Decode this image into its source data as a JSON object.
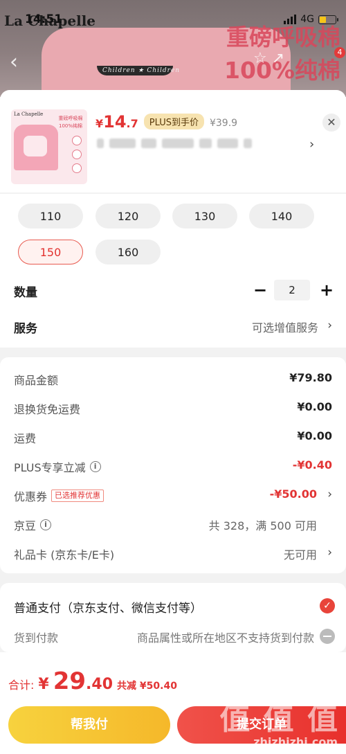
{
  "status_bar": {
    "time": "14:51",
    "network": "4G"
  },
  "banner": {
    "brand": "La Chapelle",
    "collar_text": "Children ★ Children",
    "promo_line1": "重磅呼吸棉",
    "promo_line2": "100%纯棉",
    "cart_badge": "4"
  },
  "product": {
    "thumb_brand": "La Chapelle",
    "thumb_promo": "重磅呼吸棉 100%纯棉",
    "price_symbol": "¥",
    "price_int": "14",
    "price_dec": ".7",
    "plus_tag": "PLUS到手价",
    "original_price": "¥39.9"
  },
  "sizes": [
    "110",
    "120",
    "130",
    "140",
    "150",
    "160"
  ],
  "selected_size": "150",
  "quantity": {
    "label": "数量",
    "value": "2",
    "minus": "−",
    "plus": "+"
  },
  "service": {
    "label": "服务",
    "value": "可选增值服务"
  },
  "costs": {
    "goods_amount": {
      "label": "商品金额",
      "value": "¥79.80"
    },
    "return_free": {
      "label": "退换货免运费",
      "value": "¥0.00"
    },
    "shipping": {
      "label": "运费",
      "value": "¥0.00"
    },
    "plus_discount": {
      "label": "PLUS专享立减",
      "value": "-¥0.40"
    },
    "coupon": {
      "label": "优惠券",
      "tag": "已选推荐优惠",
      "value": "-¥50.00"
    },
    "jingdou": {
      "label": "京豆",
      "value": "共 328，满 500 可用"
    },
    "gift_card": {
      "label": "礼品卡 (京东卡/E卡)",
      "value": "无可用"
    }
  },
  "payment": {
    "normal": "普通支付（京东支付、微信支付等）",
    "cod_label": "货到付款",
    "cod_note": "商品属性或所在地区不支持货到付款"
  },
  "footer": {
    "total_label": "合计:",
    "total_symbol": "¥",
    "total_int": "29",
    "total_dec": ".40",
    "total_discount": "共减 ¥50.40",
    "help_pay": "帮我付",
    "submit": "提交订单",
    "watermark_big": "值 值 值",
    "watermark_small": "zhizhizhi.com"
  },
  "colors": {
    "accent_red": "#e23434",
    "plus_gold": "#f7e3b0",
    "help_yellow": "#f5c53a"
  }
}
